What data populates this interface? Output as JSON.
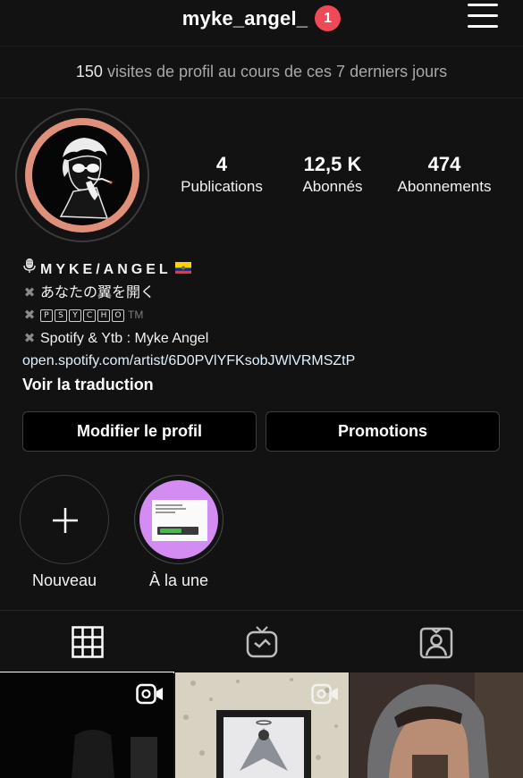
{
  "header": {
    "username": "myke_angel_",
    "notification_count": "1",
    "menu_icon": "hamburger-menu-icon"
  },
  "insights": {
    "count": "150",
    "text": "visites de profil au cours de ces 7 derniers jours"
  },
  "profile": {
    "stats": [
      {
        "value": "4",
        "label": "Publications"
      },
      {
        "value": "12,5 K",
        "label": "Abonnés"
      },
      {
        "value": "474",
        "label": "Abonnements"
      }
    ],
    "bio": {
      "name": "MYKE/ANGEL",
      "lines": [
        "あなたの翼を開く",
        "Spotify & Ytb : Myke Angel"
      ],
      "psycho_letters": [
        "P",
        "S",
        "Y",
        "C",
        "H",
        "O"
      ],
      "tm": "TM",
      "link": "open.spotify.com/artist/6D0PVlYFKsobJWlVRMSZtP",
      "translate": "Voir la traduction"
    }
  },
  "actions": {
    "edit_profile": "Modifier le profil",
    "promotions": "Promotions"
  },
  "highlights": [
    {
      "label": "Nouveau",
      "icon": "plus-icon"
    },
    {
      "label": "À la une"
    }
  ],
  "tabs": [
    {
      "icon": "grid-icon",
      "active": true
    },
    {
      "icon": "igtv-icon",
      "active": false
    },
    {
      "icon": "tagged-icon",
      "active": false
    }
  ],
  "colors": {
    "background": "#121212",
    "badge": "#ed4956",
    "avatar_ring": "#e0907a",
    "link": "#e0f1ff",
    "highlight_cover": "#d38cf2"
  }
}
